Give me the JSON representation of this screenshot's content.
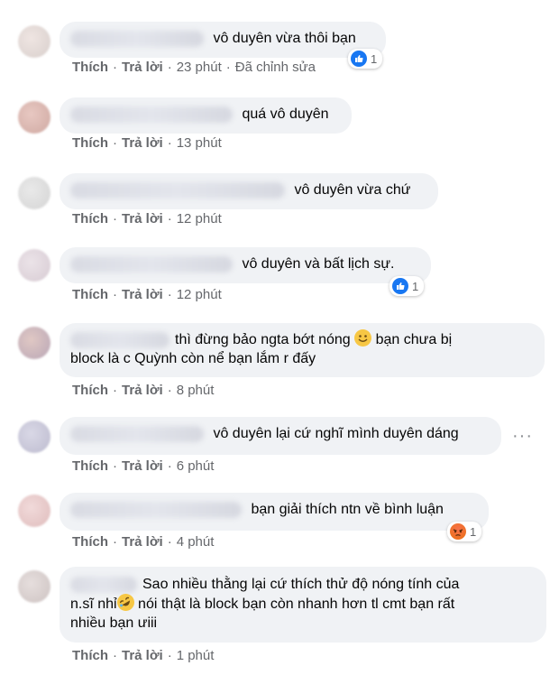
{
  "actions": {
    "like": "Thích",
    "reply": "Trả lời",
    "dot": "·"
  },
  "comments": [
    {
      "text": "vô duyên vừa thôi bạn",
      "time": "23 phút",
      "edited": "Đã chỉnh sửa",
      "reaction": {
        "icon": "like-icon",
        "count": "1"
      }
    },
    {
      "text": "quá vô duyên",
      "time": "13 phút"
    },
    {
      "text": "vô duyên vừa chứ",
      "time": "12 phút"
    },
    {
      "text": "vô duyên và bất lịch sự.",
      "time": "12 phút",
      "reaction": {
        "icon": "like-icon",
        "count": "1"
      }
    },
    {
      "text_before_emoji": "thì đừng bảo ngta bớt nóng",
      "text_after_emoji": "bạn chưa bị",
      "line2": "block là c Quỳnh còn nể bạn lắm r đấy",
      "emoji": "smile-emoji",
      "time": "8 phút"
    },
    {
      "text": "vô duyên lại cứ nghĩ mình duyên dáng",
      "time": "6 phút",
      "more": "···"
    },
    {
      "text": "bạn giải thích ntn về bình luận",
      "time": "4 phút",
      "reaction": {
        "icon": "angry-icon",
        "count": "1"
      }
    },
    {
      "line1": "Sao nhiều thằng lại cứ thích thử độ nóng tính của",
      "line2_before_emoji": "n.sĩ nhỉ",
      "line2_after_emoji": "nói thật là block bạn còn nhanh hơn tl cmt bạn rất",
      "line3": "nhiều bạn ưiii",
      "emoji": "rofl-emoji",
      "time": "1 phút"
    }
  ],
  "colors": {
    "bubble": "#f0f2f5",
    "meta": "#65676b",
    "like": "#1877f2",
    "angry": "#e9710f"
  }
}
